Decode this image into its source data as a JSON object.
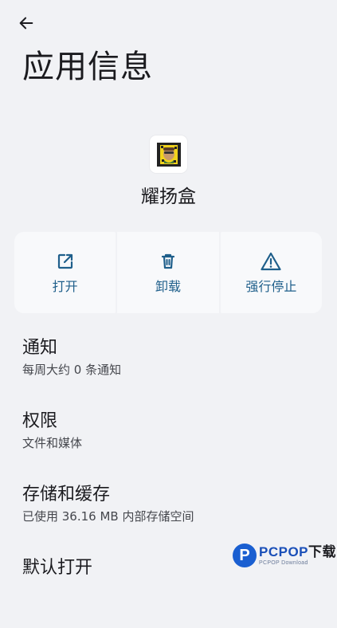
{
  "header": {
    "title": "应用信息"
  },
  "app": {
    "name": "耀扬盒"
  },
  "actions": [
    {
      "label": "打开",
      "icon": "open-external-icon"
    },
    {
      "label": "卸载",
      "icon": "trash-icon"
    },
    {
      "label": "强行停止",
      "icon": "warning-icon"
    }
  ],
  "settings": [
    {
      "title": "通知",
      "subtitle": "每周大约 0 条通知"
    },
    {
      "title": "权限",
      "subtitle": "文件和媒体"
    },
    {
      "title": "存储和缓存",
      "subtitle": "已使用 36.16 MB 内部存储空间"
    },
    {
      "title": "默认打开",
      "subtitle": ""
    }
  ],
  "watermark": {
    "logo_letter": "P",
    "main": "PCPOP",
    "highlight": "下载",
    "sub": "PCPOP Download"
  },
  "colors": {
    "accent": "#1f5f8b",
    "background": "#f1f2f5",
    "card": "#f8f9fb"
  }
}
